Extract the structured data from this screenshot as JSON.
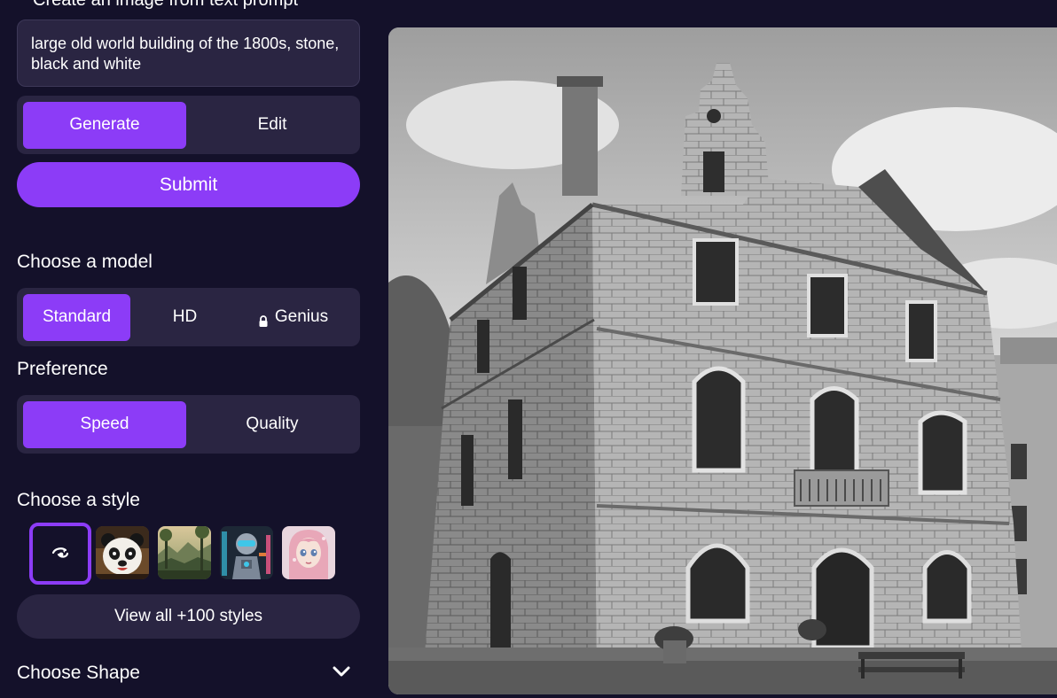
{
  "header": {
    "clipped_title": "Create an image from text prompt"
  },
  "prompt": {
    "value": "large old world building of the 1800s, stone, black and white"
  },
  "mode_toggle": {
    "options": [
      "Generate",
      "Edit"
    ],
    "active": "Generate"
  },
  "submit": {
    "label": "Submit"
  },
  "model": {
    "heading": "Choose a model",
    "options": [
      "Standard",
      "HD",
      "Genius"
    ],
    "active": "Standard",
    "locked": "Genius"
  },
  "preference": {
    "heading": "Preference",
    "options": [
      "Speed",
      "Quality"
    ],
    "active": "Speed"
  },
  "style": {
    "heading": "Choose a style",
    "thumbnails": [
      "no-style-icon",
      "panda-style",
      "landscape-style",
      "robot-style",
      "anime-portrait-style"
    ],
    "selected": "no-style-icon",
    "view_all_label": "View all +100 styles"
  },
  "shape": {
    "heading": "Choose Shape",
    "icon": "chevron-down-icon"
  },
  "colors": {
    "background": "#14112a",
    "surface": "#2a2542",
    "accent": "#8c3cf7",
    "text": "#ffffff"
  }
}
